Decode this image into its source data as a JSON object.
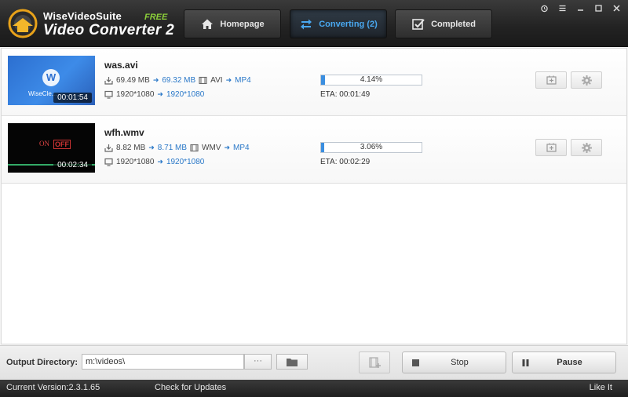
{
  "app": {
    "brand_small": "WiseVideoSuite",
    "brand_free": "FREE",
    "brand_big": "Video Converter 2"
  },
  "nav": {
    "homepage": "Homepage",
    "converting": "Converting (2)",
    "completed": "Completed"
  },
  "accent_color": "#3a8ee0",
  "tasks": [
    {
      "filename": "was.avi",
      "duration": "00:01:54",
      "src_size": "69.49 MB",
      "dst_size": "69.32 MB",
      "src_format": "AVI",
      "dst_format": "MP4",
      "src_res": "1920*1080",
      "dst_res": "1920*1080",
      "progress_text": "4.14%",
      "progress": 0.0414,
      "eta": "ETA: 00:01:49"
    },
    {
      "filename": "wfh.wmv",
      "duration": "00:02:34",
      "src_size": "8.82 MB",
      "dst_size": "8.71 MB",
      "src_format": "WMV",
      "dst_format": "MP4",
      "src_res": "1920*1080",
      "dst_res": "1920*1080",
      "progress_text": "3.06%",
      "progress": 0.0306,
      "eta": "ETA: 00:02:29"
    }
  ],
  "bottom": {
    "output_label": "Output Directory:",
    "output_value": "m:\\videos\\",
    "dots": "···",
    "stop": "Stop",
    "pause": "Pause"
  },
  "status": {
    "version": "Current Version:2.3.1.65",
    "check_updates": "Check for Updates",
    "like": "Like It"
  }
}
